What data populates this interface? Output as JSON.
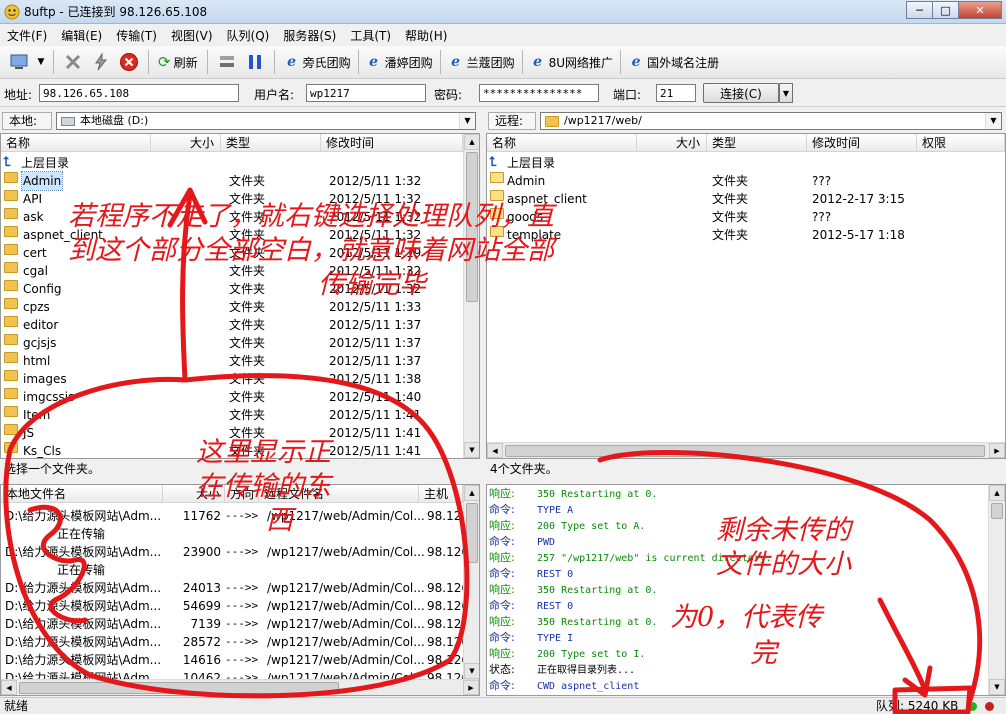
{
  "window": {
    "title": "8uftp - 已连接到 98.126.65.108"
  },
  "menu": [
    "文件(F)",
    "编辑(E)",
    "传输(T)",
    "视图(V)",
    "队列(Q)",
    "服务器(S)",
    "工具(T)",
    "帮助(H)"
  ],
  "toolbar": {
    "refresh_label": "刷新",
    "links": [
      "旁氏团购",
      "潘婷团购",
      "兰蔻团购",
      "8U网络推广",
      "国外域名注册"
    ]
  },
  "address": {
    "host_label": "地址:",
    "host_value": "98.126.65.108",
    "user_label": "用户名:",
    "user_value": "wp1217",
    "pass_label": "密码:",
    "pass_value": "***************",
    "port_label": "端口:",
    "port_value": "21",
    "connect_label": "连接(C)"
  },
  "local": {
    "label": "本地:",
    "path": "本地磁盘 (D:)",
    "columns": [
      "名称",
      "大小",
      "类型",
      "修改时间"
    ],
    "up_label": "上层目录",
    "rows": [
      {
        "name": "Admin",
        "type": "文件夹",
        "time": "2012/5/11 1:32"
      },
      {
        "name": "API",
        "type": "文件夹",
        "time": "2012/5/11 1:32"
      },
      {
        "name": "ask",
        "type": "文件夹",
        "time": "2012/5/11 1:32"
      },
      {
        "name": "aspnet_client",
        "type": "文件夹",
        "time": "2012/5/11 1:32"
      },
      {
        "name": "cert",
        "type": "文件夹",
        "time": "2012/5/11 1:19"
      },
      {
        "name": "cgal",
        "type": "文件夹",
        "time": "2012/5/11 1:32"
      },
      {
        "name": "Config",
        "type": "文件夹",
        "time": "2012/5/11 1:32"
      },
      {
        "name": "cpzs",
        "type": "文件夹",
        "time": "2012/5/11 1:33"
      },
      {
        "name": "editor",
        "type": "文件夹",
        "time": "2012/5/11 1:37"
      },
      {
        "name": "gcjsjs",
        "type": "文件夹",
        "time": "2012/5/11 1:37"
      },
      {
        "name": "html",
        "type": "文件夹",
        "time": "2012/5/11 1:37"
      },
      {
        "name": "images",
        "type": "文件夹",
        "time": "2012/5/11 1:38"
      },
      {
        "name": "imgcssjs",
        "type": "文件夹",
        "time": "2012/5/11 1:40"
      },
      {
        "name": "Item",
        "type": "文件夹",
        "time": "2012/5/11 1:41"
      },
      {
        "name": "JS",
        "type": "文件夹",
        "time": "2012/5/11 1:41"
      },
      {
        "name": "Ks_Cls",
        "type": "文件夹",
        "time": "2012/5/11 1:41"
      }
    ],
    "status": "选择一个文件夹。"
  },
  "remote": {
    "label": "远程:",
    "path": "/wp1217/web/",
    "columns": [
      "名称",
      "大小",
      "类型",
      "修改时间",
      "权限"
    ],
    "up_label": "上层目录",
    "rows": [
      {
        "name": "Admin",
        "type": "文件夹",
        "time": "???"
      },
      {
        "name": "aspnet_client",
        "type": "文件夹",
        "time": "2012-2-17 3:15"
      },
      {
        "name": "goods",
        "type": "文件夹",
        "time": "???"
      },
      {
        "name": "template",
        "type": "文件夹",
        "time": "2012-5-17 1:18"
      }
    ],
    "status": "4个文件夹。"
  },
  "queue": {
    "columns": [
      "本地文件名",
      "大小",
      "方向",
      "远程文件名",
      "主机"
    ],
    "rows": [
      {
        "local": "D:\\给力源头模板网站\\Adm...",
        "size": "11762",
        "dir": "--->>",
        "remote": "/wp1217/web/Admin/Col...",
        "host": "98.126",
        "sub": "正在传输"
      },
      {
        "local": "D:\\给力源头模板网站\\Adm...",
        "size": "23900",
        "dir": "--->>",
        "remote": "/wp1217/web/Admin/Col...",
        "host": "98.126",
        "sub": "正在传输"
      },
      {
        "local": "D:\\给力源头模板网站\\Adm...",
        "size": "24013",
        "dir": "--->>",
        "remote": "/wp1217/web/Admin/Col...",
        "host": "98.126",
        "sub": ""
      },
      {
        "local": "D:\\给力源头模板网站\\Adm...",
        "size": "54699",
        "dir": "--->>",
        "remote": "/wp1217/web/Admin/Col...",
        "host": "98.126",
        "sub": ""
      },
      {
        "local": "D:\\给力源头模板网站\\Adm...",
        "size": "7139",
        "dir": "--->>",
        "remote": "/wp1217/web/Admin/Col...",
        "host": "98.126",
        "sub": ""
      },
      {
        "local": "D:\\给力源头模板网站\\Adm...",
        "size": "28572",
        "dir": "--->>",
        "remote": "/wp1217/web/Admin/Col...",
        "host": "98.126",
        "sub": ""
      },
      {
        "local": "D:\\给力源头模板网站\\Adm...",
        "size": "14616",
        "dir": "--->>",
        "remote": "/wp1217/web/Admin/Col...",
        "host": "98.126",
        "sub": ""
      },
      {
        "local": "D:\\给力源头模板网站\\Adm...",
        "size": "10462",
        "dir": "--->>",
        "remote": "/wp1217/web/Admin/Col...",
        "host": "98.126",
        "sub": ""
      }
    ]
  },
  "log": [
    {
      "kind": "resp",
      "key": "响应:",
      "text": "350 Restarting at 0."
    },
    {
      "kind": "cmd",
      "key": "命令:",
      "text": "TYPE A"
    },
    {
      "kind": "resp",
      "key": "响应:",
      "text": "200 Type set to A."
    },
    {
      "kind": "cmd",
      "key": "命令:",
      "text": "PWD"
    },
    {
      "kind": "resp",
      "key": "响应:",
      "text": "257 \"/wp1217/web\" is current directory."
    },
    {
      "kind": "cmd",
      "key": "命令:",
      "text": "REST 0"
    },
    {
      "kind": "resp",
      "key": "响应:",
      "text": "350 Restarting at 0."
    },
    {
      "kind": "cmd",
      "key": "命令:",
      "text": "REST 0"
    },
    {
      "kind": "resp",
      "key": "响应:",
      "text": "350 Restarting at 0."
    },
    {
      "kind": "cmd",
      "key": "命令:",
      "text": "TYPE I"
    },
    {
      "kind": "resp",
      "key": "响应:",
      "text": "200 Type set to I."
    },
    {
      "kind": "stat",
      "key": "状态:",
      "text": "正在取得目录列表..."
    },
    {
      "kind": "cmd",
      "key": "命令:",
      "text": "CWD aspnet_client"
    }
  ],
  "statusbar": {
    "left": "就绪",
    "queue_size": "队列: 5240 KB"
  },
  "annotations": {
    "top": [
      "若程序不走了，就右键选择处理队列，直",
      "到这个部分全部空白，就意味着网站全部",
      "传输完毕"
    ],
    "middle": [
      "这里显示正",
      "在传输的东",
      "西"
    ],
    "right": [
      "剩余未传的",
      "文件的大小",
      "为0，代表传",
      "完"
    ]
  },
  "colors": {
    "annotation": "#e4171a",
    "log_response": "#0a8a0a",
    "log_command": "#1b2fa8",
    "selection": "#cde6ff"
  }
}
